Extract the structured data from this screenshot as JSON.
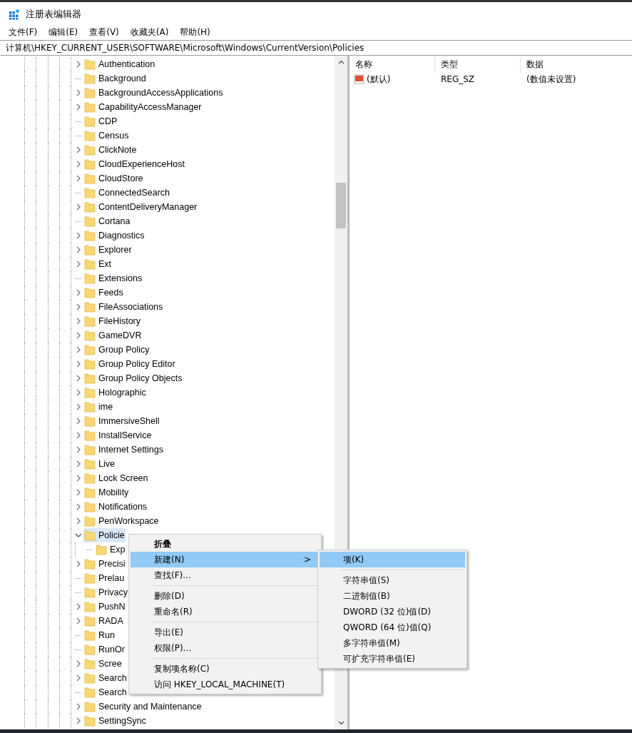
{
  "window": {
    "title": "注册表编辑器"
  },
  "menu_bar": [
    "文件(F)",
    "编辑(E)",
    "查看(V)",
    "收藏夹(A)",
    "帮助(H)"
  ],
  "address": "计算机\\HKEY_CURRENT_USER\\SOFTWARE\\Microsoft\\Windows\\CurrentVersion\\Policies",
  "tree": [
    {
      "label": "Authentication",
      "expandable": true,
      "expanded": false,
      "selected": false
    },
    {
      "label": "Background",
      "expandable": false,
      "expanded": false,
      "selected": false
    },
    {
      "label": "BackgroundAccessApplications",
      "expandable": true,
      "expanded": false,
      "selected": false
    },
    {
      "label": "CapabilityAccessManager",
      "expandable": true,
      "expanded": false,
      "selected": false
    },
    {
      "label": "CDP",
      "expandable": false,
      "expanded": false,
      "selected": false
    },
    {
      "label": "Census",
      "expandable": false,
      "expanded": false,
      "selected": false
    },
    {
      "label": "ClickNote",
      "expandable": true,
      "expanded": false,
      "selected": false
    },
    {
      "label": "CloudExperienceHost",
      "expandable": true,
      "expanded": false,
      "selected": false
    },
    {
      "label": "CloudStore",
      "expandable": true,
      "expanded": false,
      "selected": false
    },
    {
      "label": "ConnectedSearch",
      "expandable": false,
      "expanded": false,
      "selected": false
    },
    {
      "label": "ContentDeliveryManager",
      "expandable": true,
      "expanded": false,
      "selected": false
    },
    {
      "label": "Cortana",
      "expandable": false,
      "expanded": false,
      "selected": false
    },
    {
      "label": "Diagnostics",
      "expandable": true,
      "expanded": false,
      "selected": false
    },
    {
      "label": "Explorer",
      "expandable": true,
      "expanded": false,
      "selected": false
    },
    {
      "label": "Ext",
      "expandable": true,
      "expanded": false,
      "selected": false
    },
    {
      "label": "Extensions",
      "expandable": false,
      "expanded": false,
      "selected": false
    },
    {
      "label": "Feeds",
      "expandable": true,
      "expanded": false,
      "selected": false
    },
    {
      "label": "FileAssociations",
      "expandable": true,
      "expanded": false,
      "selected": false
    },
    {
      "label": "FileHistory",
      "expandable": true,
      "expanded": false,
      "selected": false
    },
    {
      "label": "GameDVR",
      "expandable": true,
      "expanded": false,
      "selected": false
    },
    {
      "label": "Group Policy",
      "expandable": true,
      "expanded": false,
      "selected": false
    },
    {
      "label": "Group Policy Editor",
      "expandable": true,
      "expanded": false,
      "selected": false
    },
    {
      "label": "Group Policy Objects",
      "expandable": true,
      "expanded": false,
      "selected": false
    },
    {
      "label": "Holographic",
      "expandable": true,
      "expanded": false,
      "selected": false
    },
    {
      "label": "ime",
      "expandable": true,
      "expanded": false,
      "selected": false
    },
    {
      "label": "ImmersiveShell",
      "expandable": true,
      "expanded": false,
      "selected": false
    },
    {
      "label": "InstallService",
      "expandable": true,
      "expanded": false,
      "selected": false
    },
    {
      "label": "Internet Settings",
      "expandable": true,
      "expanded": false,
      "selected": false
    },
    {
      "label": "Live",
      "expandable": true,
      "expanded": false,
      "selected": false
    },
    {
      "label": "Lock Screen",
      "expandable": true,
      "expanded": false,
      "selected": false
    },
    {
      "label": "Mobility",
      "expandable": true,
      "expanded": false,
      "selected": false
    },
    {
      "label": "Notifications",
      "expandable": true,
      "expanded": false,
      "selected": false
    },
    {
      "label": "PenWorkspace",
      "expandable": true,
      "expanded": false,
      "selected": false
    },
    {
      "label": "Policie",
      "expandable": true,
      "expanded": true,
      "selected": true,
      "children": [
        {
          "label": "Exp",
          "expandable": false,
          "expanded": false,
          "selected": false
        }
      ]
    },
    {
      "label": "Precisi",
      "expandable": true,
      "expanded": false,
      "selected": false
    },
    {
      "label": "Prelau",
      "expandable": false,
      "expanded": false,
      "selected": false
    },
    {
      "label": "Privacy",
      "expandable": false,
      "expanded": false,
      "selected": false
    },
    {
      "label": "PushN",
      "expandable": true,
      "expanded": false,
      "selected": false
    },
    {
      "label": "RADA",
      "expandable": true,
      "expanded": false,
      "selected": false
    },
    {
      "label": "Run",
      "expandable": false,
      "expanded": false,
      "selected": false
    },
    {
      "label": "RunOr",
      "expandable": false,
      "expanded": false,
      "selected": false
    },
    {
      "label": "Scree",
      "expandable": true,
      "expanded": false,
      "selected": false
    },
    {
      "label": "Search",
      "expandable": true,
      "expanded": false,
      "selected": false
    },
    {
      "label": "Search",
      "expandable": false,
      "expanded": false,
      "selected": false
    },
    {
      "label": "Security and Maintenance",
      "expandable": true,
      "expanded": false,
      "selected": false
    },
    {
      "label": "SettingSync",
      "expandable": true,
      "expanded": false,
      "selected": false
    }
  ],
  "values": {
    "columns": [
      "名称",
      "类型",
      "数据"
    ],
    "rows": [
      {
        "name": "(默认)",
        "type": "REG_SZ",
        "data": "(数值未设置)"
      }
    ]
  },
  "context_menu": [
    {
      "kind": "item",
      "label": "折叠",
      "bold": true,
      "selected": false
    },
    {
      "kind": "item",
      "label": "新建(N)",
      "bold": false,
      "selected": true,
      "submenu_arrow": ">"
    },
    {
      "kind": "item",
      "label": "查找(F)...",
      "bold": false,
      "selected": false
    },
    {
      "kind": "separator"
    },
    {
      "kind": "item",
      "label": "删除(D)",
      "bold": false,
      "selected": false
    },
    {
      "kind": "item",
      "label": "重命名(R)",
      "bold": false,
      "selected": false
    },
    {
      "kind": "separator"
    },
    {
      "kind": "item",
      "label": "导出(E)",
      "bold": false,
      "selected": false
    },
    {
      "kind": "item",
      "label": "权限(P)...",
      "bold": false,
      "selected": false
    },
    {
      "kind": "separator"
    },
    {
      "kind": "item",
      "label": "复制项名称(C)",
      "bold": false,
      "selected": false
    },
    {
      "kind": "item",
      "label": "访问 HKEY_LOCAL_MACHINE(T)",
      "bold": false,
      "selected": false
    }
  ],
  "submenu": [
    {
      "kind": "item",
      "label": "项(K)",
      "bold": false,
      "selected": true
    },
    {
      "kind": "separator"
    },
    {
      "kind": "item",
      "label": "字符串值(S)",
      "bold": false,
      "selected": false
    },
    {
      "kind": "item",
      "label": "二进制值(B)",
      "bold": false,
      "selected": false
    },
    {
      "kind": "item",
      "label": "DWORD (32 位)值(D)",
      "bold": false,
      "selected": false
    },
    {
      "kind": "item",
      "label": "QWORD (64 位)值(Q)",
      "bold": false,
      "selected": false
    },
    {
      "kind": "item",
      "label": "多字符串值(M)",
      "bold": false,
      "selected": false
    },
    {
      "kind": "item",
      "label": "可扩充字符串值(E)",
      "bold": false,
      "selected": false
    }
  ]
}
